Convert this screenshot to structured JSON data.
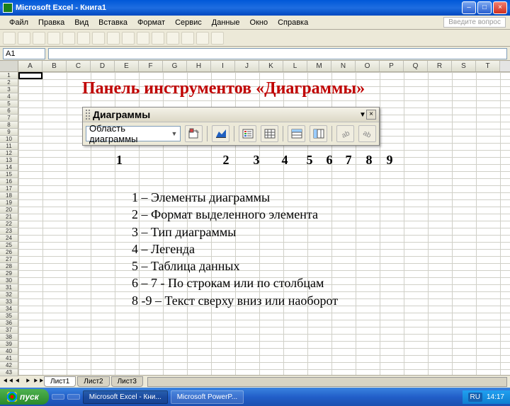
{
  "titlebar": {
    "text": "Microsoft Excel - Книга1",
    "min": "–",
    "max": "□",
    "close": "×"
  },
  "menubar": {
    "items": [
      "Файл",
      "Правка",
      "Вид",
      "Вставка",
      "Формат",
      "Сервис",
      "Данные",
      "Окно",
      "Справка"
    ],
    "help_hint": "Введите вопрос"
  },
  "formula": {
    "active_cell": "A1"
  },
  "columns": [
    "A",
    "B",
    "C",
    "D",
    "E",
    "F",
    "G",
    "H",
    "I",
    "J",
    "K",
    "L",
    "M",
    "N",
    "O",
    "P",
    "Q",
    "R",
    "S",
    "T"
  ],
  "rows_count": 43,
  "chart_panel": {
    "title": "Панель инструментов «Диаграммы»",
    "toolbar_label": "Диаграммы",
    "select_value": "Область диаграммы",
    "nums": [
      "1",
      "2",
      "3",
      "4",
      "5",
      "6",
      "7",
      "8",
      "9"
    ],
    "legend": [
      "1 – Элементы диаграммы",
      "2 – Формат выделенного элемента",
      "3 – Тип диаграммы",
      "4 – Легенда",
      "5 – Таблица данных",
      "6 – 7  - По строкам или по столбцам",
      "8 -9 – Текст сверху вниз или наоборот"
    ]
  },
  "sheet_tabs": {
    "tabs": [
      "Лист1",
      "Лист2",
      "Лист3"
    ],
    "active": 0
  },
  "taskbar": {
    "start": "пуск",
    "items": [
      "",
      "",
      "Microsoft Excel - Кни...",
      "Microsoft PowerP..."
    ],
    "lang": "RU",
    "time": "14:17"
  }
}
